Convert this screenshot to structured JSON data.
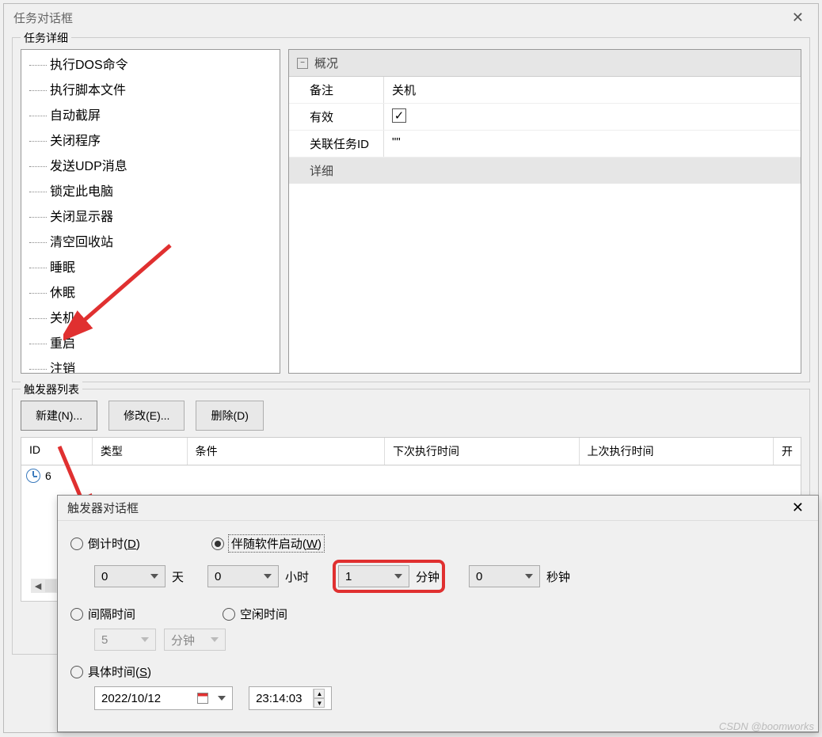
{
  "window": {
    "title": "任务对话框"
  },
  "details": {
    "label": "任务详细",
    "tree": [
      "执行DOS命令",
      "执行脚本文件",
      "自动截屏",
      "关闭程序",
      "发送UDP消息",
      "锁定此电脑",
      "关闭显示器",
      "清空回收站",
      "睡眠",
      "休眠",
      "关机",
      "重启",
      "注销"
    ],
    "overview_label": "概况",
    "props": {
      "remark_label": "备注",
      "remark_value": "关机",
      "valid_label": "有效",
      "valid_checked": true,
      "linked_label": "关联任务ID",
      "linked_value": "\"\"",
      "detail_label": "详细"
    }
  },
  "triggers": {
    "label": "触发器列表",
    "btn_new": "新建(N)...",
    "btn_edit": "修改(E)...",
    "btn_delete": "删除(D)",
    "headers": {
      "id": "ID",
      "type": "类型",
      "cond": "条件",
      "next": "下次执行时间",
      "last": "上次执行时间",
      "open": "开"
    },
    "row": {
      "id": "6"
    }
  },
  "dialog": {
    "title": "触发器对话框",
    "radio_countdown": "倒计时(",
    "radio_countdown_u": "D",
    "radio_countdown_end": ")",
    "radio_withstart": "伴随软件启动(",
    "radio_withstart_u": "W",
    "radio_withstart_end": ")",
    "radio_selected": "withstart",
    "days": "0",
    "days_label": "天",
    "hours": "0",
    "hours_label": "小时",
    "minutes": "1",
    "minutes_label": "分钟",
    "seconds": "0",
    "seconds_label": "秒钟",
    "radio_interval": "间隔时间",
    "radio_idle": "空闲时间",
    "interval_value": "5",
    "interval_unit": "分钟",
    "radio_specific": "具体时间(",
    "radio_specific_u": "S",
    "radio_specific_end": ")",
    "date": "2022/10/12",
    "time": "23:14:03"
  },
  "watermark": "CSDN @boomworks"
}
